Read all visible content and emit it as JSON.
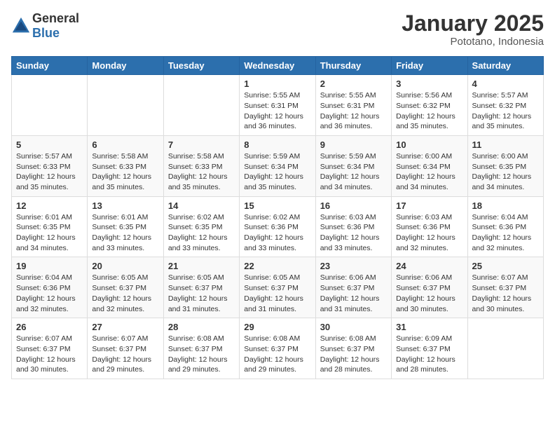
{
  "header": {
    "logo": {
      "text_general": "General",
      "text_blue": "Blue"
    },
    "title": "January 2025",
    "location": "Pototano, Indonesia"
  },
  "weekdays": [
    "Sunday",
    "Monday",
    "Tuesday",
    "Wednesday",
    "Thursday",
    "Friday",
    "Saturday"
  ],
  "weeks": [
    [
      {
        "day": "",
        "info": ""
      },
      {
        "day": "",
        "info": ""
      },
      {
        "day": "",
        "info": ""
      },
      {
        "day": "1",
        "info": "Sunrise: 5:55 AM\nSunset: 6:31 PM\nDaylight: 12 hours\nand 36 minutes."
      },
      {
        "day": "2",
        "info": "Sunrise: 5:55 AM\nSunset: 6:31 PM\nDaylight: 12 hours\nand 36 minutes."
      },
      {
        "day": "3",
        "info": "Sunrise: 5:56 AM\nSunset: 6:32 PM\nDaylight: 12 hours\nand 35 minutes."
      },
      {
        "day": "4",
        "info": "Sunrise: 5:57 AM\nSunset: 6:32 PM\nDaylight: 12 hours\nand 35 minutes."
      }
    ],
    [
      {
        "day": "5",
        "info": "Sunrise: 5:57 AM\nSunset: 6:33 PM\nDaylight: 12 hours\nand 35 minutes."
      },
      {
        "day": "6",
        "info": "Sunrise: 5:58 AM\nSunset: 6:33 PM\nDaylight: 12 hours\nand 35 minutes."
      },
      {
        "day": "7",
        "info": "Sunrise: 5:58 AM\nSunset: 6:33 PM\nDaylight: 12 hours\nand 35 minutes."
      },
      {
        "day": "8",
        "info": "Sunrise: 5:59 AM\nSunset: 6:34 PM\nDaylight: 12 hours\nand 35 minutes."
      },
      {
        "day": "9",
        "info": "Sunrise: 5:59 AM\nSunset: 6:34 PM\nDaylight: 12 hours\nand 34 minutes."
      },
      {
        "day": "10",
        "info": "Sunrise: 6:00 AM\nSunset: 6:34 PM\nDaylight: 12 hours\nand 34 minutes."
      },
      {
        "day": "11",
        "info": "Sunrise: 6:00 AM\nSunset: 6:35 PM\nDaylight: 12 hours\nand 34 minutes."
      }
    ],
    [
      {
        "day": "12",
        "info": "Sunrise: 6:01 AM\nSunset: 6:35 PM\nDaylight: 12 hours\nand 34 minutes."
      },
      {
        "day": "13",
        "info": "Sunrise: 6:01 AM\nSunset: 6:35 PM\nDaylight: 12 hours\nand 33 minutes."
      },
      {
        "day": "14",
        "info": "Sunrise: 6:02 AM\nSunset: 6:35 PM\nDaylight: 12 hours\nand 33 minutes."
      },
      {
        "day": "15",
        "info": "Sunrise: 6:02 AM\nSunset: 6:36 PM\nDaylight: 12 hours\nand 33 minutes."
      },
      {
        "day": "16",
        "info": "Sunrise: 6:03 AM\nSunset: 6:36 PM\nDaylight: 12 hours\nand 33 minutes."
      },
      {
        "day": "17",
        "info": "Sunrise: 6:03 AM\nSunset: 6:36 PM\nDaylight: 12 hours\nand 32 minutes."
      },
      {
        "day": "18",
        "info": "Sunrise: 6:04 AM\nSunset: 6:36 PM\nDaylight: 12 hours\nand 32 minutes."
      }
    ],
    [
      {
        "day": "19",
        "info": "Sunrise: 6:04 AM\nSunset: 6:36 PM\nDaylight: 12 hours\nand 32 minutes."
      },
      {
        "day": "20",
        "info": "Sunrise: 6:05 AM\nSunset: 6:37 PM\nDaylight: 12 hours\nand 32 minutes."
      },
      {
        "day": "21",
        "info": "Sunrise: 6:05 AM\nSunset: 6:37 PM\nDaylight: 12 hours\nand 31 minutes."
      },
      {
        "day": "22",
        "info": "Sunrise: 6:05 AM\nSunset: 6:37 PM\nDaylight: 12 hours\nand 31 minutes."
      },
      {
        "day": "23",
        "info": "Sunrise: 6:06 AM\nSunset: 6:37 PM\nDaylight: 12 hours\nand 31 minutes."
      },
      {
        "day": "24",
        "info": "Sunrise: 6:06 AM\nSunset: 6:37 PM\nDaylight: 12 hours\nand 30 minutes."
      },
      {
        "day": "25",
        "info": "Sunrise: 6:07 AM\nSunset: 6:37 PM\nDaylight: 12 hours\nand 30 minutes."
      }
    ],
    [
      {
        "day": "26",
        "info": "Sunrise: 6:07 AM\nSunset: 6:37 PM\nDaylight: 12 hours\nand 30 minutes."
      },
      {
        "day": "27",
        "info": "Sunrise: 6:07 AM\nSunset: 6:37 PM\nDaylight: 12 hours\nand 29 minutes."
      },
      {
        "day": "28",
        "info": "Sunrise: 6:08 AM\nSunset: 6:37 PM\nDaylight: 12 hours\nand 29 minutes."
      },
      {
        "day": "29",
        "info": "Sunrise: 6:08 AM\nSunset: 6:37 PM\nDaylight: 12 hours\nand 29 minutes."
      },
      {
        "day": "30",
        "info": "Sunrise: 6:08 AM\nSunset: 6:37 PM\nDaylight: 12 hours\nand 28 minutes."
      },
      {
        "day": "31",
        "info": "Sunrise: 6:09 AM\nSunset: 6:37 PM\nDaylight: 12 hours\nand 28 minutes."
      },
      {
        "day": "",
        "info": ""
      }
    ]
  ]
}
